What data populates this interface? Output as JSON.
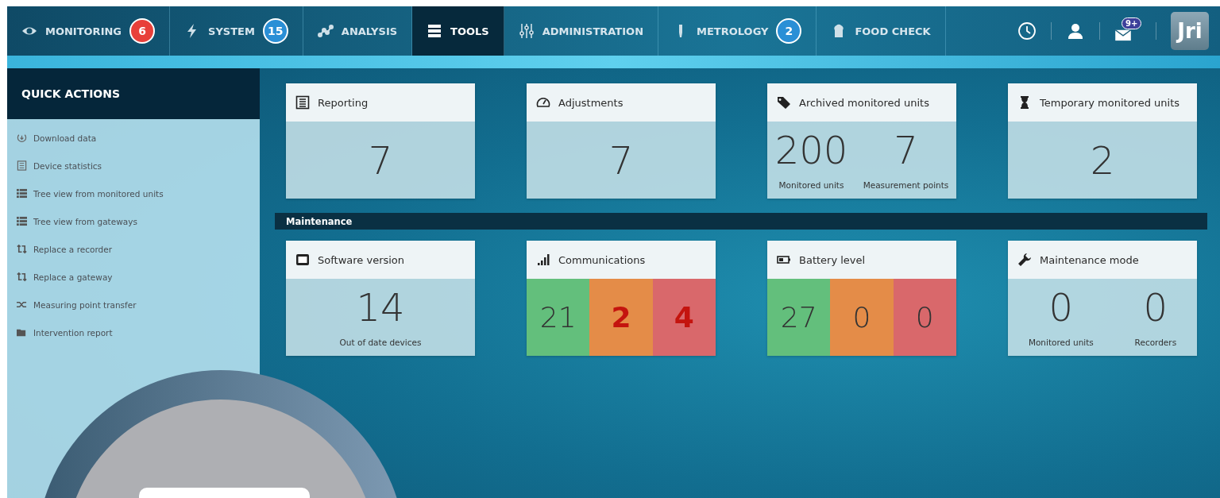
{
  "nav": {
    "tabs": [
      {
        "label": "MONITORING",
        "selected": false,
        "badge": "6",
        "color": "#e8403a"
      },
      {
        "label": "SYSTEM",
        "selected": false,
        "badge": "15",
        "color": "#2a8fd6"
      },
      {
        "label": "ANALYSIS",
        "selected": false
      },
      {
        "label": "TOOLS",
        "selected": true
      },
      {
        "label": "ADMINISTRATION",
        "selected": false
      },
      {
        "label": "METROLOGY",
        "selected": false,
        "badge": "2",
        "color": "#2a8fd6"
      },
      {
        "label": "FOOD CHECK",
        "selected": false
      }
    ],
    "mail_badge": "9+",
    "logo": "Jri"
  },
  "sidebar": {
    "title": "QUICK ACTIONS",
    "items": [
      "Download data",
      "Device statistics",
      "Tree view from monitored units",
      "Tree view from gateways",
      "Replace a recorder",
      "Replace a gateway",
      "Measuring point transfer",
      "Intervention report"
    ]
  },
  "sections": [
    {
      "tiles": [
        {
          "kind": "single",
          "title": "Reporting",
          "value": "7"
        },
        {
          "kind": "single",
          "title": "Adjustments",
          "value": "7"
        },
        {
          "kind": "double",
          "title": "Archived monitored units",
          "values": [
            {
              "value": "200",
              "caption": "Monitored units"
            },
            {
              "value": "7",
              "caption": "Measurement points"
            }
          ]
        },
        {
          "kind": "single",
          "title": "Temporary monitored units",
          "value": "2"
        }
      ]
    },
    {
      "heading": "Maintenance",
      "tiles": [
        {
          "kind": "single",
          "title": "Software version",
          "value": "14",
          "caption": "Out of date devices"
        },
        {
          "kind": "status",
          "title": "Communications",
          "cells": [
            {
              "value": "21",
              "color": "#63bf7c",
              "alert": false
            },
            {
              "value": "2",
              "color": "#e48c48",
              "alert": true
            },
            {
              "value": "4",
              "color": "#d9686b",
              "alert": true
            }
          ]
        },
        {
          "kind": "status",
          "title": "Battery level",
          "cells": [
            {
              "value": "27",
              "color": "#63bf7c",
              "alert": false
            },
            {
              "value": "0",
              "color": "#e48c48",
              "alert": false
            },
            {
              "value": "0",
              "color": "#d9686b",
              "alert": false
            }
          ]
        },
        {
          "kind": "double",
          "title": "Maintenance mode",
          "values": [
            {
              "value": "0",
              "caption": "Monitored units"
            },
            {
              "value": "0",
              "caption": "Recorders"
            }
          ]
        }
      ]
    }
  ]
}
